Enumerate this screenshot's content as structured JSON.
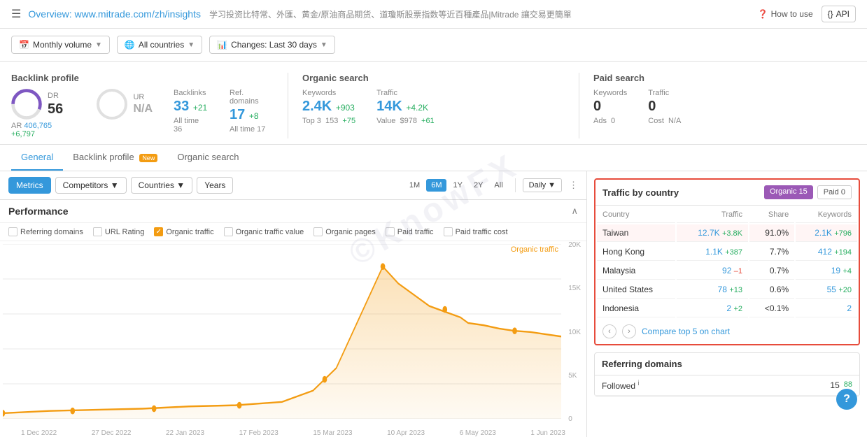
{
  "nav": {
    "title": "Overview:",
    "url": "www.mitrade.com/zh/insights",
    "subtitle": "学习投资比特常、外匯、黄金/原油商品期货、道瓊斯股票指数等近百種產品|Mitrade 讓交易更簡單",
    "how_to_use": "How to use",
    "api": "API"
  },
  "filters": {
    "monthly_volume": "Monthly volume",
    "all_countries": "All countries",
    "changes": "Changes: Last 30 days"
  },
  "backlink_profile": {
    "title": "Backlink profile",
    "dr_label": "DR",
    "dr_value": "56",
    "ur_label": "UR",
    "ur_value": "N/A",
    "backlinks_label": "Backlinks",
    "backlinks_value": "33",
    "backlinks_change": "+21",
    "backlinks_alltime_label": "All time",
    "backlinks_alltime_value": "36",
    "ref_domains_label": "Ref. domains",
    "ref_domains_value": "17",
    "ref_domains_change": "+8",
    "ref_domains_alltime_label": "All time",
    "ref_domains_alltime_value": "17",
    "ar_label": "AR",
    "ar_value": "406,765",
    "ar_change": "+6,797"
  },
  "organic_search": {
    "title": "Organic search",
    "keywords_label": "Keywords",
    "keywords_value": "2.4K",
    "keywords_change": "+903",
    "keywords_top3": "Top 3",
    "keywords_top3_value": "153",
    "keywords_top3_change": "+75",
    "traffic_label": "Traffic",
    "traffic_value": "14K",
    "traffic_change": "+4.2K",
    "traffic_value_label": "Value",
    "traffic_value_val": "$978",
    "traffic_value_change": "+61"
  },
  "paid_search": {
    "title": "Paid search",
    "keywords_label": "Keywords",
    "keywords_value": "0",
    "traffic_label": "Traffic",
    "traffic_value": "0",
    "ads_label": "Ads",
    "ads_value": "0",
    "cost_label": "Cost",
    "cost_value": "N/A"
  },
  "tabs": {
    "general": "General",
    "backlink_profile": "Backlink profile",
    "backlink_badge": "New",
    "organic_search": "Organic search"
  },
  "chart_toolbar": {
    "metrics": "Metrics",
    "competitors": "Competitors",
    "countries": "Countries",
    "years": "Years",
    "time_1m": "1M",
    "time_6m": "6M",
    "time_1y": "1Y",
    "time_2y": "2Y",
    "time_all": "All",
    "daily": "Daily"
  },
  "performance": {
    "title": "Performance",
    "referring_domains": "Referring domains",
    "url_rating": "URL Rating",
    "organic_traffic": "Organic traffic",
    "organic_traffic_value": "Organic traffic value",
    "organic_pages": "Organic pages",
    "paid_traffic": "Paid traffic",
    "paid_traffic_cost": "Paid traffic cost",
    "chart_label": "Organic traffic",
    "y_labels": [
      "20K",
      "15K",
      "10K",
      "5K",
      "0"
    ],
    "x_labels": [
      "1 Dec 2022",
      "27 Dec 2022",
      "22 Jan 2023",
      "17 Feb 2023",
      "15 Mar 2023",
      "10 Apr 2023",
      "6 May 2023",
      "1 Jun 2023"
    ]
  },
  "traffic_by_country": {
    "title": "Traffic by country",
    "organic_tab": "Organic",
    "organic_count": "15",
    "paid_tab": "Paid",
    "paid_count": "0",
    "col_country": "Country",
    "col_traffic": "Traffic",
    "col_share": "Share",
    "col_keywords": "Keywords",
    "rows": [
      {
        "country": "Taiwan",
        "traffic": "12.7K",
        "traffic_change": "+3.8K",
        "share": "91.0%",
        "keywords": "2.1K",
        "keywords_change": "+796",
        "highlighted": true
      },
      {
        "country": "Hong Kong",
        "traffic": "1.1K",
        "traffic_change": "+387",
        "share": "7.7%",
        "keywords": "412",
        "keywords_change": "+194",
        "highlighted": false
      },
      {
        "country": "Malaysia",
        "traffic": "92",
        "traffic_change": "–1",
        "share": "0.7%",
        "keywords": "19",
        "keywords_change": "+4",
        "highlighted": false
      },
      {
        "country": "United States",
        "traffic": "78",
        "traffic_change": "+13",
        "share": "0.6%",
        "keywords": "55",
        "keywords_change": "+20",
        "highlighted": false
      },
      {
        "country": "Indonesia",
        "traffic": "2",
        "traffic_change": "+2",
        "share": "<0.1%",
        "keywords": "2",
        "keywords_change": "",
        "highlighted": false
      }
    ],
    "compare_label": "Compare top 5 on chart"
  },
  "referring_domains": {
    "title": "Referring domains",
    "followed_label": "Followed",
    "followed_value": "15",
    "followed_change": "88"
  },
  "watermark": "©KnowFX"
}
